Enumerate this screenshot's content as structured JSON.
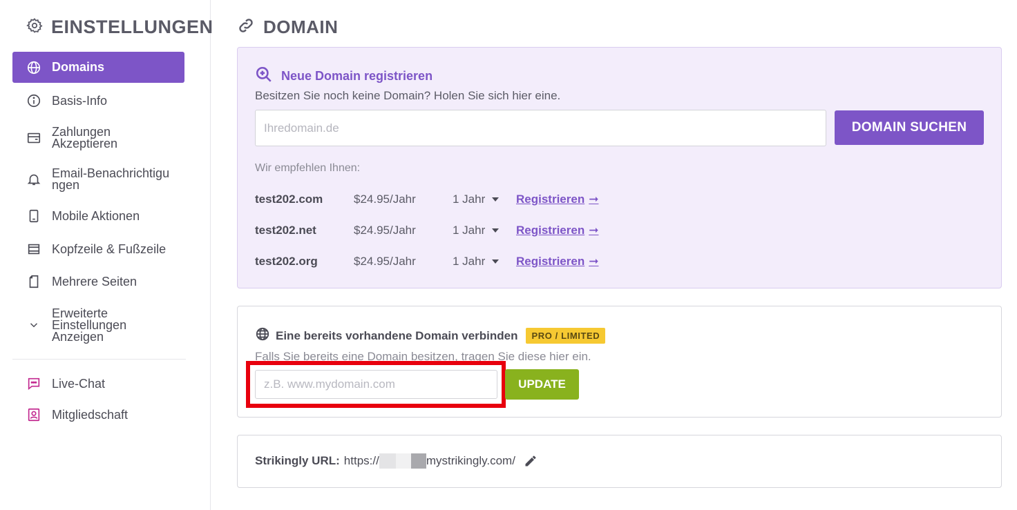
{
  "sidebar": {
    "title": "EINSTELLUNGEN",
    "title_icon": "gear-icon",
    "items": [
      {
        "label": "Domains",
        "icon": "globe-icon",
        "active": true
      },
      {
        "label": "Basis-Info",
        "icon": "info-icon"
      },
      {
        "label": "Zahlungen Akzeptieren",
        "icon": "wallet-icon"
      },
      {
        "label": "Email-Benachrichtigungen",
        "icon": "bell-icon"
      },
      {
        "label": "Mobile Aktionen",
        "icon": "mobile-icon"
      },
      {
        "label": "Kopfzeile & Fußzeile",
        "icon": "layout-icon"
      },
      {
        "label": "Mehrere Seiten",
        "icon": "page-icon"
      },
      {
        "label": "Erweiterte Einstellungen Anzeigen",
        "icon": "chevron-down-icon"
      }
    ],
    "extra_items": [
      {
        "label": "Live-Chat",
        "icon": "chat-icon"
      },
      {
        "label": "Mitgliedschaft",
        "icon": "member-icon"
      }
    ],
    "accent_color": "#7d55c7",
    "extra_icon_color": "#c2288f"
  },
  "main": {
    "title": "DOMAIN",
    "title_icon": "link-icon",
    "register": {
      "heading": "Neue Domain registrieren",
      "subtitle": "Besitzen Sie noch keine Domain? Holen Sie sich hier eine.",
      "input_placeholder": "Ihredomain.de",
      "button_label": "DOMAIN SUCHEN",
      "recommend_label": "Wir empfehlen Ihnen:",
      "suggestions": [
        {
          "domain": "test202.com",
          "price": "$24.95/Jahr",
          "term": "1 Jahr",
          "action": "Registrieren"
        },
        {
          "domain": "test202.net",
          "price": "$24.95/Jahr",
          "term": "1 Jahr",
          "action": "Registrieren"
        },
        {
          "domain": "test202.org",
          "price": "$24.95/Jahr",
          "term": "1 Jahr",
          "action": "Registrieren"
        }
      ]
    },
    "connect": {
      "heading": "Eine bereits vorhandene Domain verbinden",
      "badge": "PRO / LIMITED",
      "subtitle": "Falls Sie bereits eine Domain besitzen, tragen Sie diese hier ein.",
      "input_placeholder": "z.B. www.mydomain.com",
      "button_label": "UPDATE",
      "button_color": "#89b21e",
      "highlight_color": "#e8000d"
    },
    "url": {
      "label": "Strikingly URL:",
      "prefix": "https://",
      "suffix": "mystrikingly.com/"
    }
  }
}
